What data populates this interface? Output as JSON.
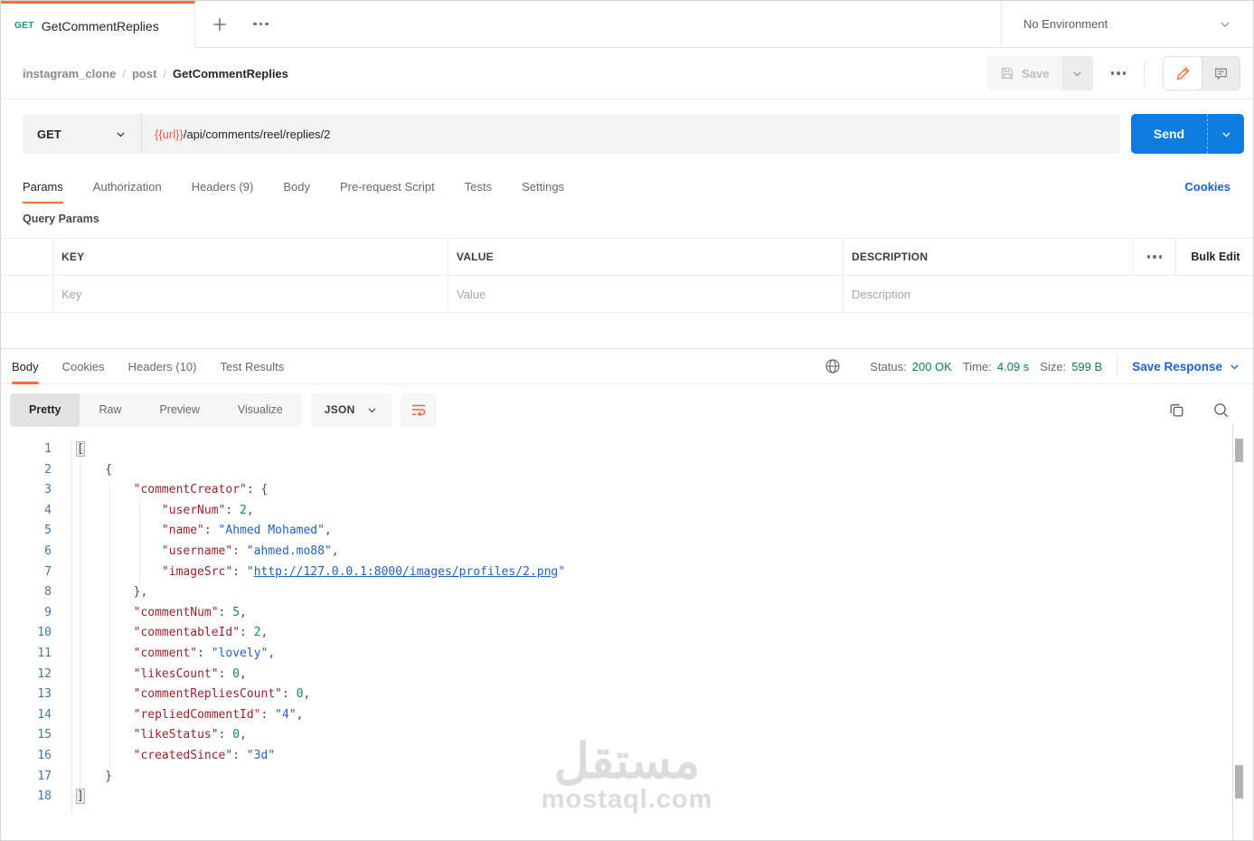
{
  "tab_bar": {
    "active_tab": {
      "method": "GET",
      "title": "GetCommentReplies"
    },
    "environment": "No Environment"
  },
  "header": {
    "breadcrumb": {
      "collection": "instagram_clone",
      "folder": "post",
      "request": "GetCommentReplies",
      "separator": "/"
    },
    "save_label": "Save"
  },
  "request": {
    "method": "GET",
    "url": {
      "variable": "{{url}}",
      "path": "/api/comments/reel/replies/2"
    },
    "send_label": "Send",
    "tabs": [
      "Params",
      "Authorization",
      "Headers (9)",
      "Body",
      "Pre-request Script",
      "Tests",
      "Settings"
    ],
    "active_tab": "Params",
    "cookies_link": "Cookies",
    "section_label": "Query Params",
    "params_table": {
      "col_key": "KEY",
      "col_value": "VALUE",
      "col_description": "DESCRIPTION",
      "bulk_edit": "Bulk Edit",
      "row": {
        "key_placeholder": "Key",
        "value_placeholder": "Value",
        "description_placeholder": "Description"
      }
    }
  },
  "response": {
    "tabs": [
      "Body",
      "Cookies",
      "Headers (10)",
      "Test Results"
    ],
    "active_tab": "Body",
    "meta": {
      "status_label": "Status:",
      "status_value": "200 OK",
      "time_label": "Time:",
      "time_value": "4.09 s",
      "size_label": "Size:",
      "size_value": "599 B"
    },
    "save_response_label": "Save Response",
    "view_modes": [
      "Pretty",
      "Raw",
      "Preview",
      "Visualize"
    ],
    "active_view": "Pretty",
    "format": "JSON",
    "response_data": [
      {
        "commentCreator": {
          "userNum": 2,
          "name": "Ahmed Mohamed",
          "username": "ahmed.mo88",
          "imageSrc": "http://127.0.0.1:8000/images/profiles/2.png"
        },
        "commentNum": 5,
        "commentableId": 2,
        "comment": "lovely",
        "likesCount": 0,
        "commentRepliesCount": 0,
        "repliedCommentId": "4",
        "likeStatus": 0,
        "createdSince": "3d"
      }
    ],
    "code_lines": [
      [
        [
          "b",
          "["
        ]
      ],
      [
        [
          "p",
          "    {"
        ]
      ],
      [
        [
          "p",
          "        "
        ],
        [
          "k",
          "\"commentCreator\""
        ],
        [
          "p",
          ": {"
        ]
      ],
      [
        [
          "p",
          "            "
        ],
        [
          "k",
          "\"userNum\""
        ],
        [
          "p",
          ": "
        ],
        [
          "n",
          "2"
        ],
        [
          "p",
          ","
        ]
      ],
      [
        [
          "p",
          "            "
        ],
        [
          "k",
          "\"name\""
        ],
        [
          "p",
          ": "
        ],
        [
          "s",
          "\"Ahmed Mohamed\""
        ],
        [
          "p",
          ","
        ]
      ],
      [
        [
          "p",
          "            "
        ],
        [
          "k",
          "\"username\""
        ],
        [
          "p",
          ": "
        ],
        [
          "s",
          "\"ahmed.mo88\""
        ],
        [
          "p",
          ","
        ]
      ],
      [
        [
          "p",
          "            "
        ],
        [
          "k",
          "\"imageSrc\""
        ],
        [
          "p",
          ": "
        ],
        [
          "s",
          "\""
        ],
        [
          "l",
          "http://127.0.0.1:8000/images/profiles/2.png"
        ],
        [
          "s",
          "\""
        ]
      ],
      [
        [
          "p",
          "        },"
        ]
      ],
      [
        [
          "p",
          "        "
        ],
        [
          "k",
          "\"commentNum\""
        ],
        [
          "p",
          ": "
        ],
        [
          "n",
          "5"
        ],
        [
          "p",
          ","
        ]
      ],
      [
        [
          "p",
          "        "
        ],
        [
          "k",
          "\"commentableId\""
        ],
        [
          "p",
          ": "
        ],
        [
          "n",
          "2"
        ],
        [
          "p",
          ","
        ]
      ],
      [
        [
          "p",
          "        "
        ],
        [
          "k",
          "\"comment\""
        ],
        [
          "p",
          ": "
        ],
        [
          "s",
          "\"lovely\""
        ],
        [
          "p",
          ","
        ]
      ],
      [
        [
          "p",
          "        "
        ],
        [
          "k",
          "\"likesCount\""
        ],
        [
          "p",
          ": "
        ],
        [
          "n",
          "0"
        ],
        [
          "p",
          ","
        ]
      ],
      [
        [
          "p",
          "        "
        ],
        [
          "k",
          "\"commentRepliesCount\""
        ],
        [
          "p",
          ": "
        ],
        [
          "n",
          "0"
        ],
        [
          "p",
          ","
        ]
      ],
      [
        [
          "p",
          "        "
        ],
        [
          "k",
          "\"repliedCommentId\""
        ],
        [
          "p",
          ": "
        ],
        [
          "s",
          "\"4\""
        ],
        [
          "p",
          ","
        ]
      ],
      [
        [
          "p",
          "        "
        ],
        [
          "k",
          "\"likeStatus\""
        ],
        [
          "p",
          ": "
        ],
        [
          "n",
          "0"
        ],
        [
          "p",
          ","
        ]
      ],
      [
        [
          "p",
          "        "
        ],
        [
          "k",
          "\"createdSince\""
        ],
        [
          "p",
          ": "
        ],
        [
          "s",
          "\"3d\""
        ]
      ],
      [
        [
          "p",
          "    }"
        ]
      ],
      [
        [
          "b",
          "]"
        ]
      ]
    ]
  },
  "watermark": {
    "logo": "مستقل",
    "site": "mostaql.com"
  },
  "colors": {
    "accent": "#ff6c37",
    "send_blue": "#0d7ce0",
    "link_blue": "#1764d2",
    "success_green": "#0f7a62",
    "method_get_teal": "#0c9a84",
    "variable_orange": "#e05b41"
  }
}
